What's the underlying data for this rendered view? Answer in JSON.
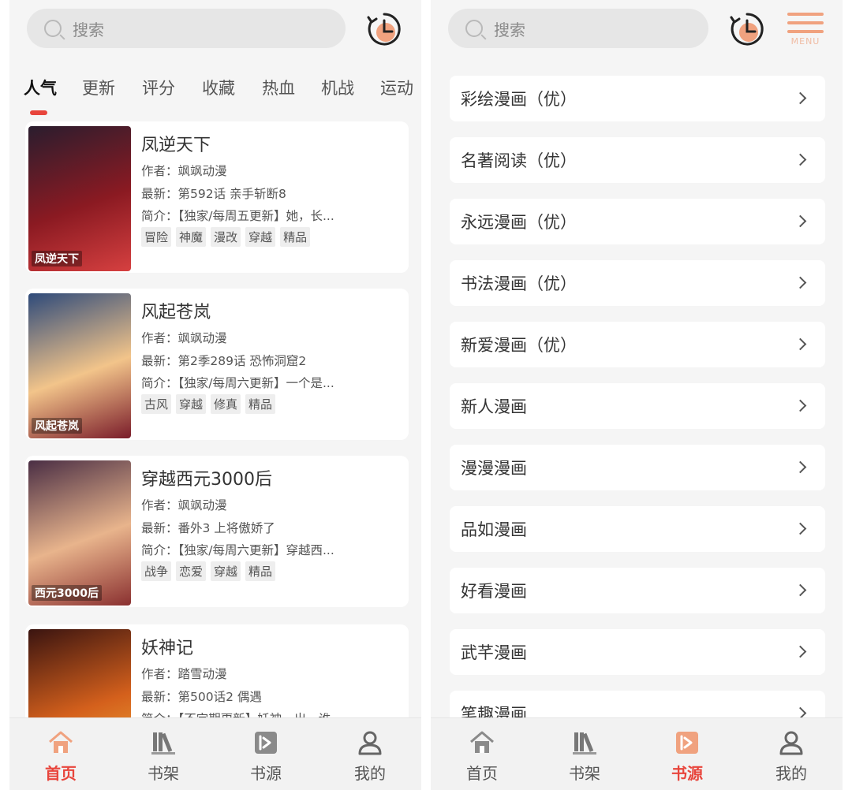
{
  "left": {
    "search_placeholder": "搜索",
    "tabs": [
      "人气",
      "更新",
      "评分",
      "收藏",
      "热血",
      "机战",
      "运动"
    ],
    "comics": [
      {
        "title": "凤逆天下",
        "author": "作者：飒飒动漫",
        "latest": "最新：第592话 亲手斩断8",
        "intro": "简介：【独家/每周五更新】她，长...",
        "tags": [
          "冒险",
          "神魔",
          "漫改",
          "穿越",
          "精品"
        ],
        "cover_colors": [
          "#2a1d2e",
          "#8b1a22",
          "#d64040"
        ]
      },
      {
        "title": "风起苍岚",
        "author": "作者：飒飒动漫",
        "latest": "最新：第2季289话 恐怖洞窟2",
        "intro": "简介：【独家/每周六更新】一个是...",
        "tags": [
          "古风",
          "穿越",
          "修真",
          "精品"
        ],
        "cover_colors": [
          "#2e4a7a",
          "#f2c48a",
          "#7a1c2a"
        ]
      },
      {
        "title": "穿越西元3000后",
        "author": "作者：飒飒动漫",
        "latest": "最新：番外3 上将傲娇了",
        "intro": "简介：【独家/每周六更新】穿越西...",
        "tags": [
          "战争",
          "恋爱",
          "穿越",
          "精品"
        ],
        "cover_colors": [
          "#4a2e44",
          "#e8b48c",
          "#8a3030"
        ]
      },
      {
        "title": "妖神记",
        "author": "作者：踏雪动漫",
        "latest": "最新：第500话2 偶遇",
        "intro": "简介：【不定期更新】妖神一出，谁...",
        "tags": [],
        "cover_colors": [
          "#3a1410",
          "#d4601c",
          "#f2b03a"
        ]
      }
    ],
    "cover_tags": [
      "凤逆天下",
      "风起苍岚",
      "西元3000后",
      ""
    ],
    "nav": [
      {
        "label": "首页",
        "icon": "home-icon",
        "active": true
      },
      {
        "label": "书架",
        "icon": "bookshelf-icon",
        "active": false
      },
      {
        "label": "书源",
        "icon": "book-source-icon",
        "active": false
      },
      {
        "label": "我的",
        "icon": "profile-icon",
        "active": false
      }
    ]
  },
  "right": {
    "search_placeholder": "搜索",
    "menu_label": "MENU",
    "sources": [
      "彩绘漫画（优）",
      "名著阅读（优）",
      "永远漫画（优）",
      "书法漫画（优）",
      "新爱漫画（优）",
      "新人漫画",
      "漫漫漫画",
      "品如漫画",
      "好看漫画",
      "武芊漫画",
      "笔趣漫画"
    ],
    "nav": [
      {
        "label": "首页",
        "icon": "home-icon",
        "active": false
      },
      {
        "label": "书架",
        "icon": "bookshelf-icon",
        "active": false
      },
      {
        "label": "书源",
        "icon": "book-source-icon",
        "active": true
      },
      {
        "label": "我的",
        "icon": "profile-icon",
        "active": false
      }
    ]
  },
  "colors": {
    "accent": "#e8453c",
    "icon_orange": "#f0a27f",
    "search_bg": "#e6e6e6",
    "page_bg": "#f5f5f5"
  }
}
